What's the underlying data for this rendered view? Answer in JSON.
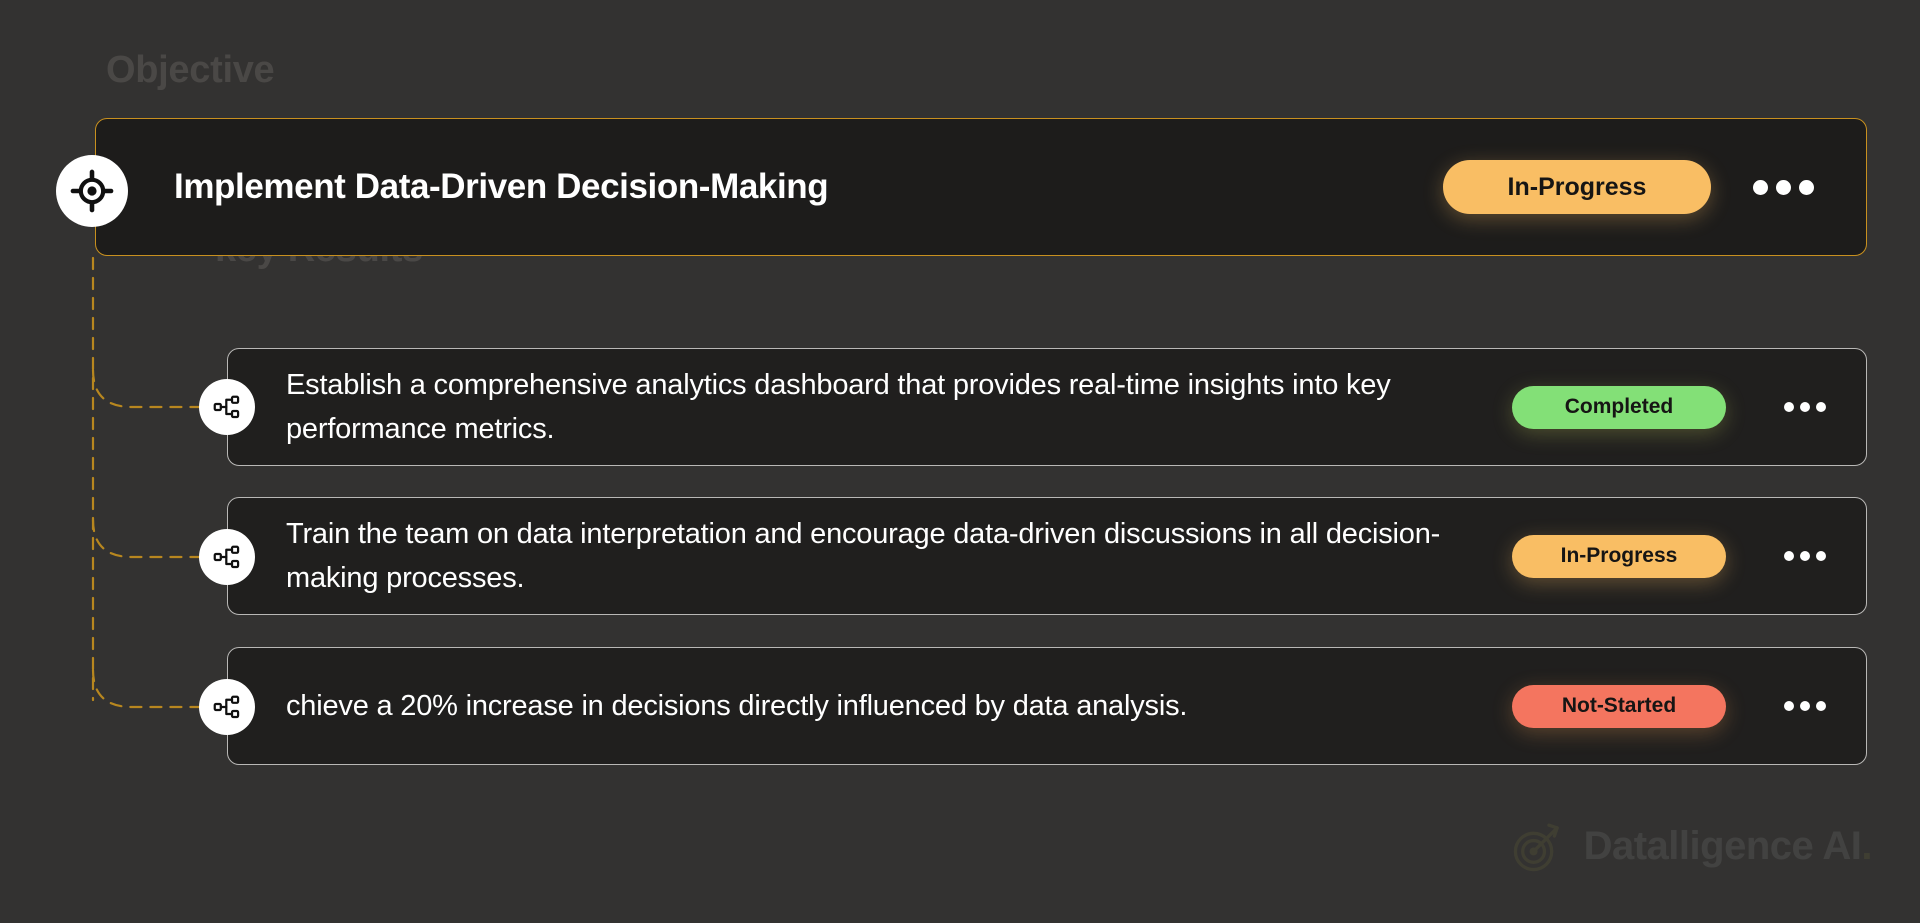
{
  "theme": {
    "page_background": "#333231",
    "card_background": "#1d1c1b",
    "objective_border": "#c8901f",
    "keyresult_border": "#b9b8b6",
    "connector_color": "#b8871f",
    "label_color": "#4a4846",
    "text_color": "#ffffff",
    "status_inprogress": "#f9be64",
    "status_completed": "#83e077",
    "status_notstarted": "#f4755f"
  },
  "labels": {
    "objective": "Objective",
    "key_results": "key Results"
  },
  "objective": {
    "icon": "target-crosshair-icon",
    "title": "Implement Data-Driven Decision-Making",
    "status": "In-Progress",
    "status_color": "#f9be64",
    "menu_icon": "kebab-menu-icon"
  },
  "key_results": [
    {
      "icon": "hierarchy-icon",
      "text": "Establish a comprehensive analytics dashboard that provides real-time insights into key performance metrics.",
      "status": "Completed",
      "status_color": "#83e077",
      "menu_icon": "kebab-menu-icon"
    },
    {
      "icon": "hierarchy-icon",
      "text": "Train the team on data interpretation and encourage data-driven discussions in all decision-making processes.",
      "status": "In-Progress",
      "status_color": "#f9be64",
      "menu_icon": "kebab-menu-icon"
    },
    {
      "icon": "hierarchy-icon",
      "text": "chieve a 20% increase in decisions directly influenced by data analysis.",
      "status": "Not-Started",
      "status_color": "#f4755f",
      "menu_icon": "kebab-menu-icon"
    }
  ],
  "watermark": {
    "icon": "target-arrow-logo-icon",
    "text": "Datalligence AI",
    "dot": "."
  }
}
